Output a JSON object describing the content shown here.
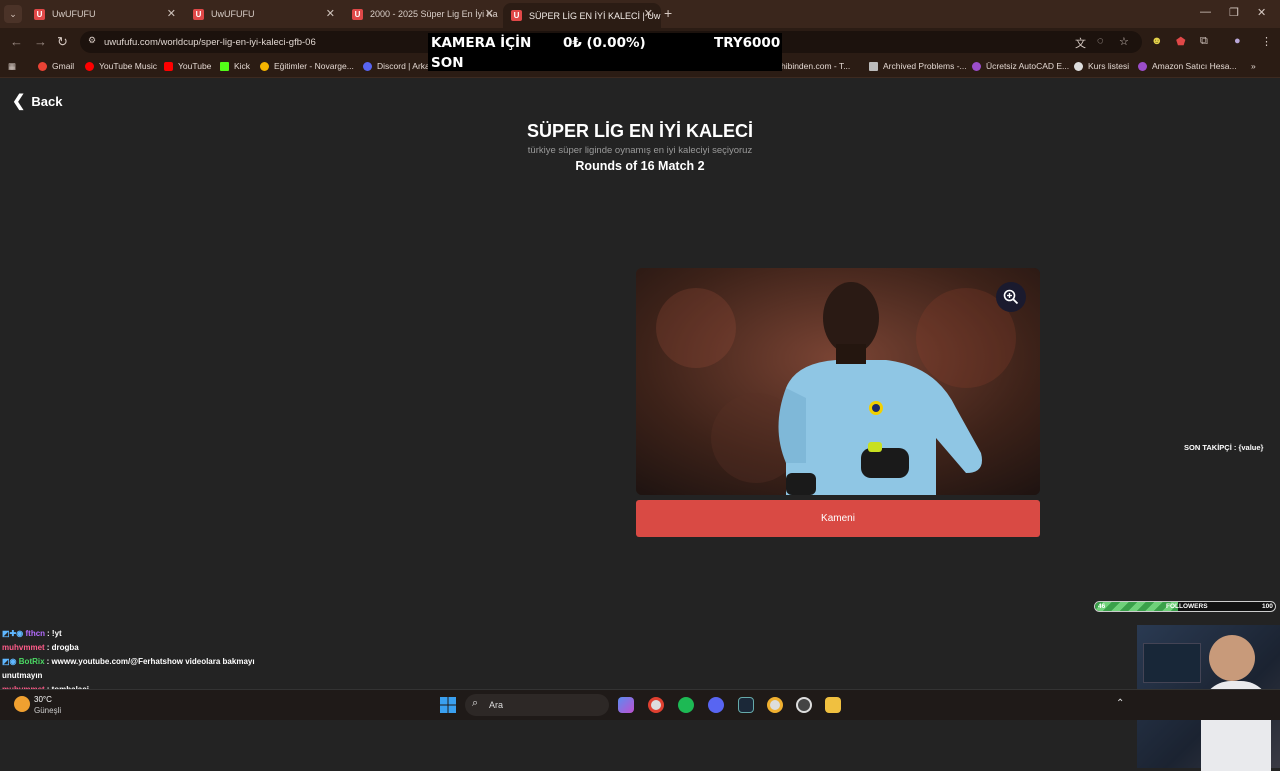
{
  "browser": {
    "tabs": [
      {
        "title": "UwUFUFU",
        "favicon": "U"
      },
      {
        "title": "UwUFUFU",
        "favicon": "U"
      },
      {
        "title": "2000 - 2025 Süper Lig En İyi Ka",
        "favicon": "U"
      },
      {
        "title": "SÜPER LİG EN İYİ KALECİ | UwU",
        "favicon": "U"
      }
    ],
    "new_tab": "+",
    "url": "uwufufu.com/worldcup/sper-lig-en-iyi-kaleci-gfb-06",
    "bookmarks": [
      {
        "label": "Gmail",
        "color": "#ea4335"
      },
      {
        "label": "YouTube Music",
        "color": "#ff0000"
      },
      {
        "label": "YouTube",
        "color": "#ff0000"
      },
      {
        "label": "Kick",
        "color": "#53fc18"
      },
      {
        "label": "Eğitimler - Novarge...",
        "color": "#f5b400"
      },
      {
        "label": "Discord | Arka",
        "color": "#5865f2"
      },
      {
        "label": "sahibinden.com - T...",
        "color": "#f7d200"
      },
      {
        "label": "Archived Problems -...",
        "color": "#bbbbbb"
      },
      {
        "label": "Ücretsiz AutoCAD E...",
        "color": "#9b4dca"
      },
      {
        "label": "Kurs listesi",
        "color": "#dddddd"
      },
      {
        "label": "Amazon Satıcı Hesa...",
        "color": "#9b4dca"
      }
    ]
  },
  "overlay": {
    "label1": "KAMERA İÇİN",
    "label2": "SON",
    "amount": "0₺ (0.00%)",
    "goal": "TRY6000"
  },
  "page": {
    "back_label": "Back",
    "title": "SÜPER LİG EN İYİ KALECİ",
    "subtitle": "türkiye süper liginde oynamış en iyi kaleciyi seçiyoruz",
    "round": "Rounds of 16 Match 2",
    "candidate_name": "Kameni"
  },
  "stream": {
    "son_takipci": "SON TAKİPÇİ : {value}",
    "followers_current": "46",
    "followers_label": "FOLLOWERS",
    "followers_goal": "100",
    "followers_fraction": 0.46,
    "chat": [
      {
        "user": "fthcn",
        "text": ": !yt",
        "color": "#b46cff",
        "badges": true
      },
      {
        "user": "muhvmmet",
        "text": ": drogba",
        "color": "#ff5c8a",
        "badges": false
      },
      {
        "user": "BotRix",
        "text": ": wwww.youtube.com/@Ferhatshow videolara bakmayı",
        "color": "#4cd964",
        "badges": true
      },
      {
        "user": "",
        "text": "unutmayın",
        "color": "#ffffff",
        "badges": false
      },
      {
        "user": "muhvmmet",
        "text": ": tombalaci",
        "color": "#ff5c8a",
        "badges": false
      }
    ]
  },
  "taskbar": {
    "temperature": "30°C",
    "condition": "Güneşli",
    "search_label": "Ara"
  }
}
